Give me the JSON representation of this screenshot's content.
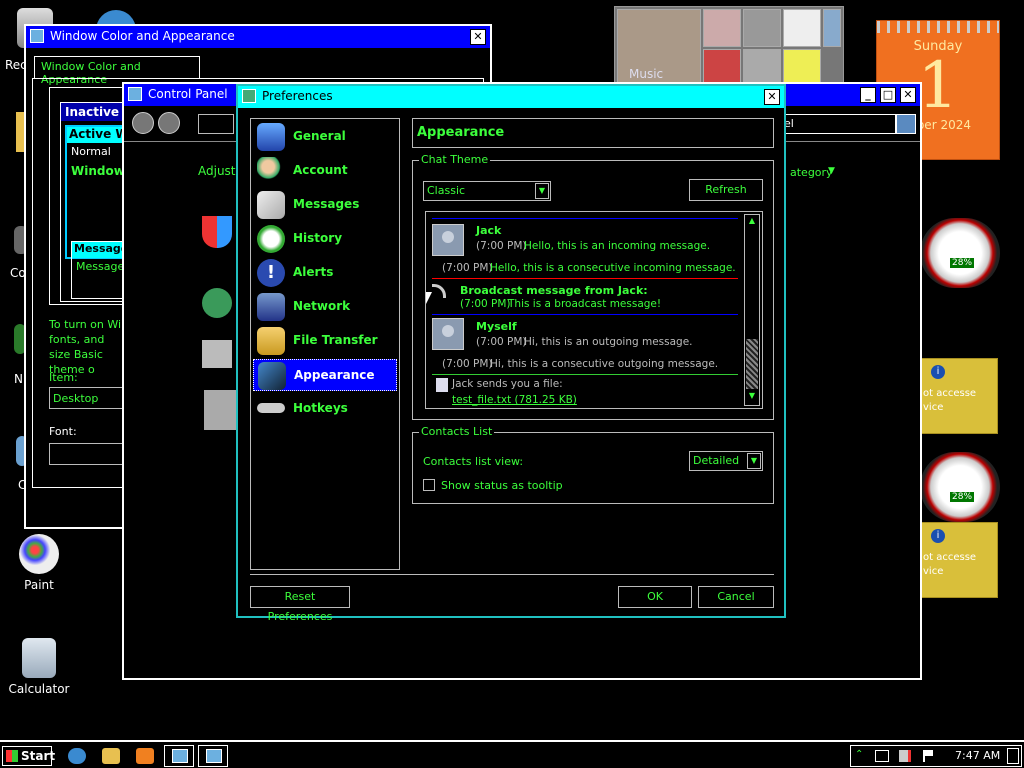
{
  "desktop": {
    "icons": [
      {
        "label": "Rec",
        "icon": "recycle-bin-icon"
      },
      {
        "label": "Co",
        "icon": "computer-icon"
      },
      {
        "label": "N",
        "icon": "network-icon"
      },
      {
        "label": "C",
        "icon": "control-icon"
      },
      {
        "label": "Paint",
        "icon": "paint-icon"
      },
      {
        "label": "Calculator",
        "icon": "calculator-icon"
      }
    ]
  },
  "widgets": {
    "calendar": {
      "day_name": "Sunday",
      "day": "1",
      "month": "mber 2024"
    },
    "media_label": "Music",
    "gauge_pct_1": "28%",
    "gauge_pct_2": "28%",
    "notice_1": "ot accesse vice",
    "notice_2": "ot accesse vice"
  },
  "wca_window": {
    "title": "Window Color and Appearance",
    "tab": "Window Color and Appearance",
    "preview": {
      "inactive": "Inactive W",
      "active": "Active W",
      "normal": "Normal",
      "window": "Window",
      "message": "Message",
      "message_text": "Message"
    },
    "help_text": "To turn on Wi fonts, and size Basic theme o",
    "item_label": "Item:",
    "item_value": "Desktop",
    "font_label": "Font:"
  },
  "control_panel": {
    "title": "Control Panel",
    "search_value": "nel",
    "adjust": "Adjust",
    "category": "ategory"
  },
  "preferences": {
    "title": "Preferences",
    "nav": [
      {
        "label": "General",
        "icon": "monitor-icon"
      },
      {
        "label": "Account",
        "icon": "users-icon"
      },
      {
        "label": "Messages",
        "icon": "envelope-icon"
      },
      {
        "label": "History",
        "icon": "clock-icon"
      },
      {
        "label": "Alerts",
        "icon": "alert-icon"
      },
      {
        "label": "Network",
        "icon": "network-icon"
      },
      {
        "label": "File Transfer",
        "icon": "folder-icon"
      },
      {
        "label": "Appearance",
        "icon": "appearance-icon"
      },
      {
        "label": "Hotkeys",
        "icon": "keyboard-icon"
      }
    ],
    "selected_nav": "Appearance",
    "panel_title": "Appearance",
    "chat_theme": {
      "legend": "Chat Theme",
      "theme_value": "Classic",
      "refresh_label": "Refresh",
      "messages": {
        "jack_name": "Jack",
        "jack_time": "(7:00 PM)",
        "jack_text": "Hello, this is an incoming message.",
        "jack2_time": "(7:00 PM)",
        "jack2_text": "Hello, this is a consecutive incoming message.",
        "broadcast_title": "Broadcast message from Jack:",
        "broadcast_time": "(7:00 PM)",
        "broadcast_text": "This is a broadcast message!",
        "myself_name": "Myself",
        "myself_time": "(7:00 PM)",
        "myself_text": "Hi, this is an outgoing message.",
        "myself2_time": "(7:00 PM)",
        "myself2_text": "Hi, this is a consecutive outgoing message.",
        "file_text": "Jack sends you a file:",
        "file_name": "test_file.txt (781.25 KB)"
      }
    },
    "contacts": {
      "legend": "Contacts List",
      "view_label": "Contacts list view:",
      "view_value": "Detailed",
      "tooltip_label": "Show status as tooltip"
    },
    "reset_label": "Reset Preferences",
    "ok_label": "OK",
    "cancel_label": "Cancel"
  },
  "taskbar": {
    "start_label": "Start",
    "clock": "7:47 AM"
  },
  "colors": {
    "accent_green": "#3cff3c",
    "titlebar_blue": "#0000ff",
    "titlebar_cyan": "#00ffff",
    "selected": "#0000ff"
  }
}
